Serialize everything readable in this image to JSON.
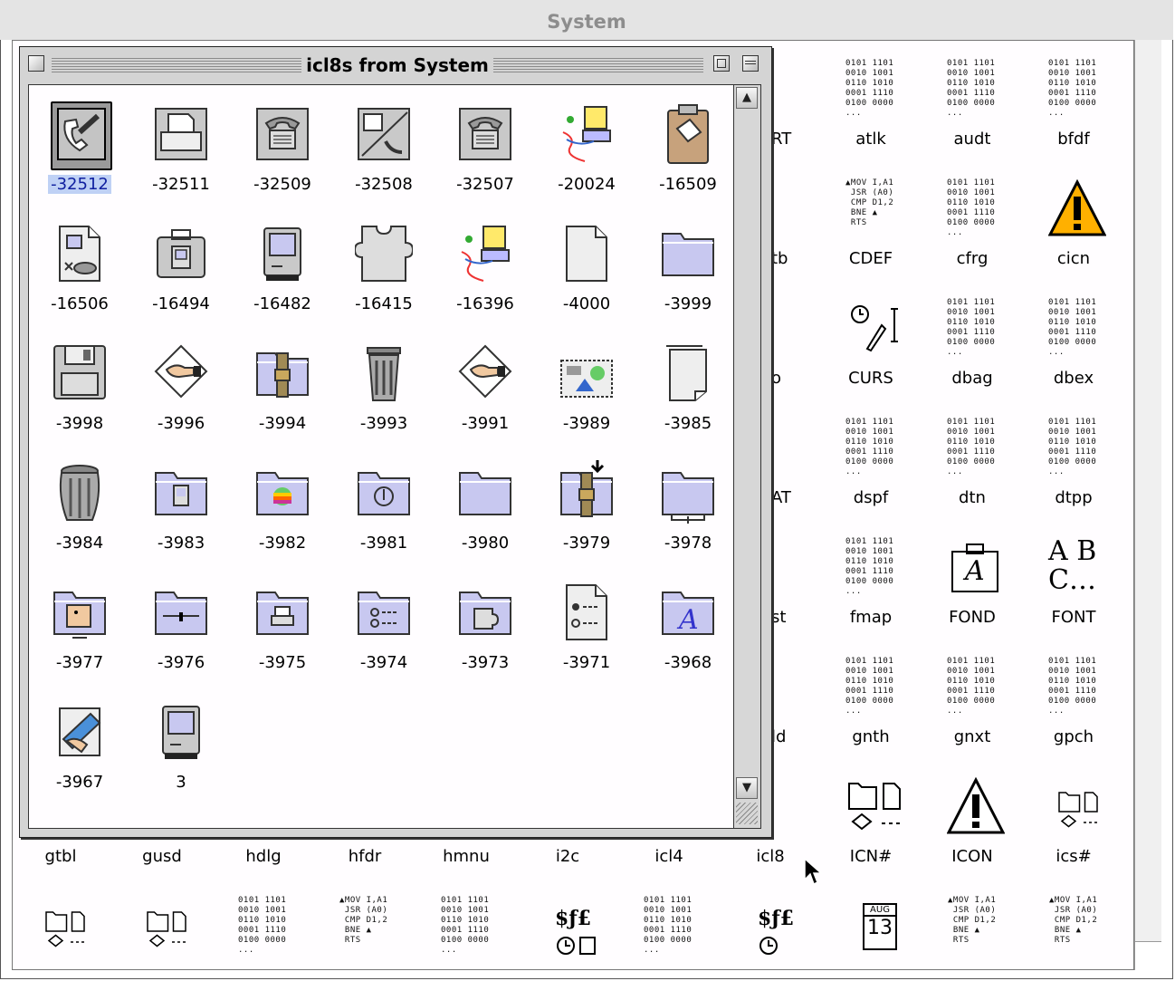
{
  "back_window": {
    "title": "System",
    "right_columns": [
      {
        "label": "atlk",
        "icon": "binary"
      },
      {
        "label": "audt",
        "icon": "binary"
      },
      {
        "label": "bfdf",
        "icon": "binary"
      },
      {
        "label": "CDEF",
        "icon": "code"
      },
      {
        "label": "cfrg",
        "icon": "binary"
      },
      {
        "label": "cicn",
        "icon": "warning-color"
      },
      {
        "label": "CURS",
        "icon": "cursors"
      },
      {
        "label": "dbag",
        "icon": "binary"
      },
      {
        "label": "dbex",
        "icon": "binary"
      },
      {
        "label": "dspf",
        "icon": "binary"
      },
      {
        "label": "dtn",
        "icon": "binary"
      },
      {
        "label": "dtpp",
        "icon": "binary"
      },
      {
        "label": "fmap",
        "icon": "binary"
      },
      {
        "label": "FOND",
        "icon": "font-suitcase"
      },
      {
        "label": "FONT",
        "icon": "font-letters"
      },
      {
        "label": "gnth",
        "icon": "binary"
      },
      {
        "label": "gnxt",
        "icon": "binary"
      },
      {
        "label": "gpch",
        "icon": "binary"
      },
      {
        "label": "ICN#",
        "icon": "icon-list"
      },
      {
        "label": "ICON",
        "icon": "warning-bw"
      },
      {
        "label": "ics#",
        "icon": "icon-list-small"
      }
    ],
    "partial_labels": [
      "RT",
      "tb",
      "o",
      "AT",
      "st",
      "ld"
    ],
    "row9_labels": [
      "gtbl",
      "gusd",
      "hdlg",
      "hfdr",
      "hmnu",
      "i2c",
      "icl4",
      "icl8"
    ],
    "binary_text": "0101 1101\n0010 1001\n0110 1010\n0001 1110\n0100 0000\n...",
    "code_text": "▲MOV I,A1\n JSR (A0)\n CMP D1,2\n BNE ▲\n RTS",
    "calendar": {
      "month": "AUG",
      "day": "13"
    },
    "font_letters": "A B\nC…",
    "font_symbol": "A",
    "money_text": "$ƒ£"
  },
  "front_window": {
    "title": "icl8s from System",
    "selected": "-32512",
    "icons": [
      {
        "id": "-32512",
        "icon": "phone-card-icon"
      },
      {
        "id": "-32511",
        "icon": "printer-icon"
      },
      {
        "id": "-32509",
        "icon": "telephone-icon"
      },
      {
        "id": "-32508",
        "icon": "print-fax-icon"
      },
      {
        "id": "-32507",
        "icon": "telephone-icon"
      },
      {
        "id": "-20024",
        "icon": "mac-network-icon"
      },
      {
        "id": "-16509",
        "icon": "clipboard-icon"
      },
      {
        "id": "-16506",
        "icon": "document-disk-icon"
      },
      {
        "id": "-16494",
        "icon": "mac-suitcase-icon"
      },
      {
        "id": "-16482",
        "icon": "mac-computer-icon"
      },
      {
        "id": "-16415",
        "icon": "puzzle-piece-icon"
      },
      {
        "id": "-16396",
        "icon": "mac-network-icon"
      },
      {
        "id": "-4000",
        "icon": "blank-document-icon"
      },
      {
        "id": "-3999",
        "icon": "folder-icon"
      },
      {
        "id": "-3998",
        "icon": "floppy-disk-icon"
      },
      {
        "id": "-3996",
        "icon": "hand-diamond-icon"
      },
      {
        "id": "-3994",
        "icon": "strapped-folder-icon"
      },
      {
        "id": "-3993",
        "icon": "trash-can-icon"
      },
      {
        "id": "-3991",
        "icon": "hand-diamond-icon"
      },
      {
        "id": "-3989",
        "icon": "picture-icon"
      },
      {
        "id": "-3985",
        "icon": "stacked-document-icon"
      },
      {
        "id": "-3984",
        "icon": "full-trash-icon"
      },
      {
        "id": "-3983",
        "icon": "mac-folder-icon"
      },
      {
        "id": "-3982",
        "icon": "apple-folder-icon"
      },
      {
        "id": "-3981",
        "icon": "power-folder-icon"
      },
      {
        "id": "-3980",
        "icon": "folder-icon"
      },
      {
        "id": "-3979",
        "icon": "strapped-folder-arrow-icon"
      },
      {
        "id": "-3978",
        "icon": "network-folder-icon"
      },
      {
        "id": "-3977",
        "icon": "face-folder-icon"
      },
      {
        "id": "-3976",
        "icon": "control-panel-folder-icon"
      },
      {
        "id": "-3975",
        "icon": "printer-folder-icon"
      },
      {
        "id": "-3974",
        "icon": "radio-list-folder-icon"
      },
      {
        "id": "-3973",
        "icon": "puzzle-folder-icon"
      },
      {
        "id": "-3971",
        "icon": "radio-document-icon"
      },
      {
        "id": "-3968",
        "icon": "font-folder-icon"
      },
      {
        "id": "-3967",
        "icon": "transfer-hands-icon"
      },
      {
        "id": "3",
        "icon": "mac-computer-icon"
      }
    ]
  }
}
